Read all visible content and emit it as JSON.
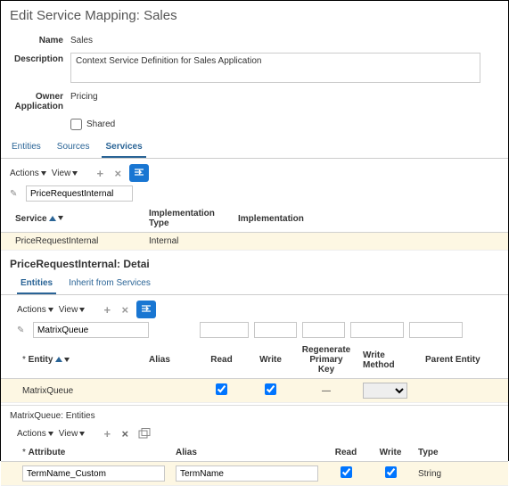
{
  "page_title": "Edit Service Mapping: Sales",
  "form": {
    "name_label": "Name",
    "name_value": "Sales",
    "desc_label": "Description",
    "desc_value": "Context Service Definition for Sales Application",
    "owner_label": "Owner Application",
    "owner_value": "Pricing",
    "shared_label": "Shared"
  },
  "tabs": {
    "entities": "Entities",
    "sources": "Sources",
    "services": "Services"
  },
  "toolbar": {
    "actions": "Actions",
    "view": "View"
  },
  "services_table": {
    "filter_value": "PriceRequestInternal",
    "col_service": "Service",
    "col_impl_type": "Implementation Type",
    "col_impl": "Implementation",
    "row_service": "PriceRequestInternal",
    "row_impl_type": "Internal"
  },
  "detail_title": "PriceRequestInternal: Detai",
  "detail_tabs": {
    "entities": "Entities",
    "inherit": "Inherit from Services"
  },
  "entities_table": {
    "filter_value": "MatrixQueue",
    "col_entity": "Entity",
    "col_alias": "Alias",
    "col_read": "Read",
    "col_write": "Write",
    "col_regen": "Regenerate Primary Key",
    "col_wmethod": "Write Method",
    "col_parent": "Parent Entity",
    "row_entity": "MatrixQueue",
    "row_regen": "—"
  },
  "attr_title": "MatrixQueue: Entities",
  "attr_table": {
    "col_attr": "Attribute",
    "col_alias": "Alias",
    "col_read": "Read",
    "col_write": "Write",
    "col_type": "Type",
    "row_attr": "TermName_Custom",
    "row_alias": "TermName",
    "row_type": "String"
  }
}
